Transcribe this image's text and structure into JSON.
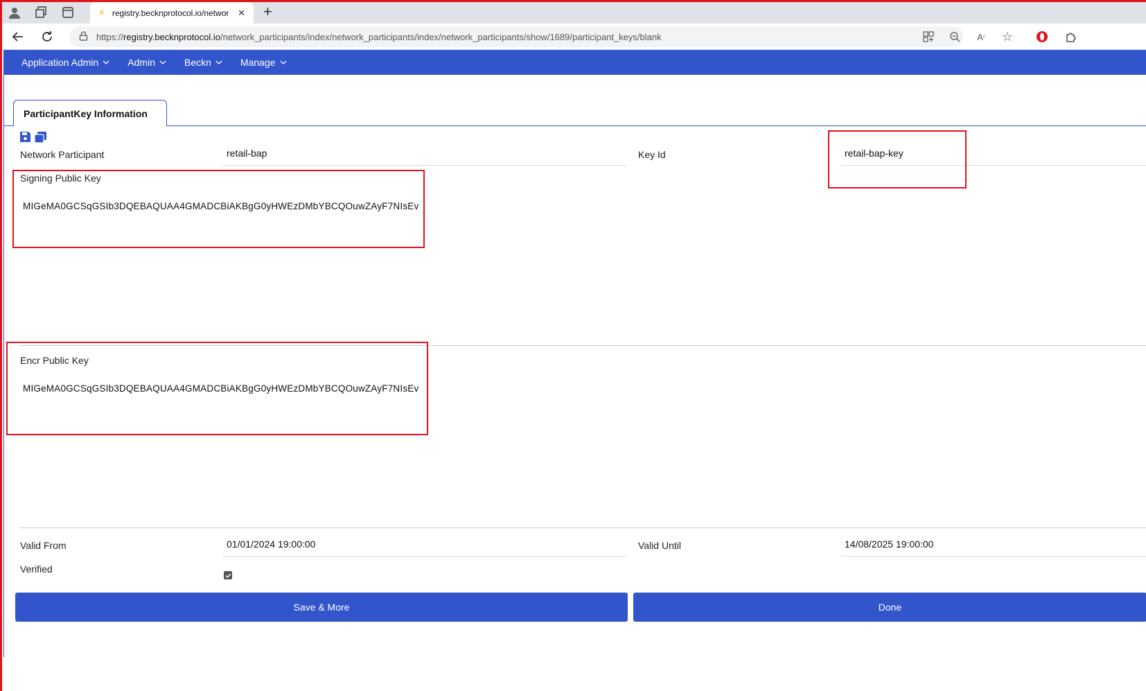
{
  "browser": {
    "tab_title": "registry.becknprotocol.io/networ",
    "url_prefix": "https://",
    "url_host": "registry.becknprotocol.io",
    "url_path": "/network_participants/index/network_participants/index/network_participants/show/1689/participant_keys/blank"
  },
  "appnav": {
    "items": [
      {
        "label": "Application Admin"
      },
      {
        "label": "Admin"
      },
      {
        "label": "Beckn"
      },
      {
        "label": "Manage"
      }
    ]
  },
  "form": {
    "tab_label": "ParticipantKey Information",
    "network_participant_label": "Network Participant",
    "network_participant_value": "retail-bap",
    "key_id_label": "Key Id",
    "key_id_value": "retail-bap-key",
    "signing_key_label": "Signing Public Key",
    "signing_key_value": "MIGeMA0GCSqGSIb3DQEBAQUAA4GMADCBiAKBgG0yHWEzDMbYBCQOuwZAyF7NIsEv",
    "encr_key_label": "Encr Public Key",
    "encr_key_value": "MIGeMA0GCSqGSIb3DQEBAQUAA4GMADCBiAKBgG0yHWEzDMbYBCQOuwZAyF7NIsEv",
    "valid_from_label": "Valid From",
    "valid_from_value": "01/01/2024 19:00:00",
    "valid_until_label": "Valid Until",
    "valid_until_value": "14/08/2025 19:00:00",
    "verified_label": "Verified",
    "verified_checked": true
  },
  "buttons": {
    "save_more": "Save & More",
    "done": "Done"
  },
  "colors": {
    "accent": "#3355cc",
    "highlight": "#e0121a"
  }
}
